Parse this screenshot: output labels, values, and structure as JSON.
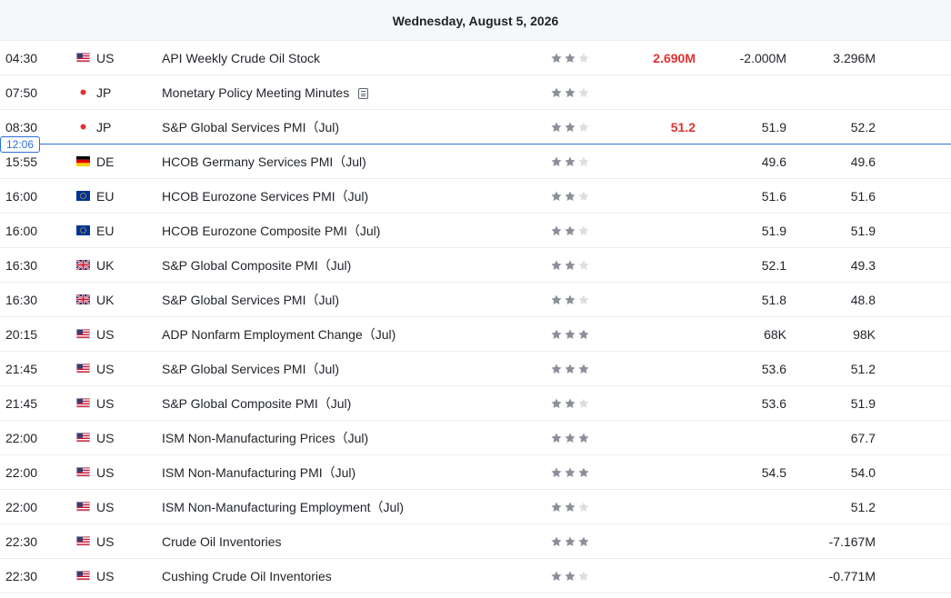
{
  "calendar": {
    "date": "Wednesday, August 5, 2026",
    "current_time": "12:06",
    "colors": {
      "actual": "#e0312e",
      "now_line": "#2f6fd6",
      "star_on": "#8b8f99",
      "star_off": "#dcdee2"
    },
    "events": [
      {
        "time": "04:30",
        "flag": "flag-us",
        "country": "US",
        "name": "API Weekly Crude Oil Stock",
        "memo": false,
        "importance": 2,
        "actual": "2.690M",
        "forecast": "-2.000M",
        "previous": "3.296M"
      },
      {
        "time": "07:50",
        "flag": "flag-jp",
        "country": "JP",
        "name": "Monetary Policy Meeting Minutes",
        "memo": true,
        "importance": 2,
        "actual": "",
        "forecast": "",
        "previous": ""
      },
      {
        "time": "08:30",
        "flag": "flag-jp",
        "country": "JP",
        "name": "S&P Global Services PMI（Jul)",
        "memo": false,
        "importance": 2,
        "actual": "51.2",
        "forecast": "51.9",
        "previous": "52.2"
      },
      {
        "time": "15:55",
        "flag": "flag-de",
        "country": "DE",
        "name": "HCOB Germany Services PMI（Jul)",
        "memo": false,
        "importance": 2,
        "actual": "",
        "forecast": "49.6",
        "previous": "49.6"
      },
      {
        "time": "16:00",
        "flag": "flag-eu",
        "country": "EU",
        "name": "HCOB Eurozone Services PMI（Jul)",
        "memo": false,
        "importance": 2,
        "actual": "",
        "forecast": "51.6",
        "previous": "51.6"
      },
      {
        "time": "16:00",
        "flag": "flag-eu",
        "country": "EU",
        "name": "HCOB Eurozone Composite PMI（Jul)",
        "memo": false,
        "importance": 2,
        "actual": "",
        "forecast": "51.9",
        "previous": "51.9"
      },
      {
        "time": "16:30",
        "flag": "flag-uk",
        "country": "UK",
        "name": "S&P Global Composite PMI（Jul)",
        "memo": false,
        "importance": 2,
        "actual": "",
        "forecast": "52.1",
        "previous": "49.3"
      },
      {
        "time": "16:30",
        "flag": "flag-uk",
        "country": "UK",
        "name": "S&P Global Services PMI（Jul)",
        "memo": false,
        "importance": 2,
        "actual": "",
        "forecast": "51.8",
        "previous": "48.8"
      },
      {
        "time": "20:15",
        "flag": "flag-us",
        "country": "US",
        "name": "ADP Nonfarm Employment Change（Jul)",
        "memo": false,
        "importance": 3,
        "actual": "",
        "forecast": "68K",
        "previous": "98K"
      },
      {
        "time": "21:45",
        "flag": "flag-us",
        "country": "US",
        "name": "S&P Global Services PMI（Jul)",
        "memo": false,
        "importance": 3,
        "actual": "",
        "forecast": "53.6",
        "previous": "51.2"
      },
      {
        "time": "21:45",
        "flag": "flag-us",
        "country": "US",
        "name": "S&P Global Composite PMI（Jul)",
        "memo": false,
        "importance": 2,
        "actual": "",
        "forecast": "53.6",
        "previous": "51.9"
      },
      {
        "time": "22:00",
        "flag": "flag-us",
        "country": "US",
        "name": "ISM Non-Manufacturing Prices（Jul)",
        "memo": false,
        "importance": 3,
        "actual": "",
        "forecast": "",
        "previous": "67.7"
      },
      {
        "time": "22:00",
        "flag": "flag-us",
        "country": "US",
        "name": "ISM Non-Manufacturing PMI（Jul)",
        "memo": false,
        "importance": 3,
        "actual": "",
        "forecast": "54.5",
        "previous": "54.0"
      },
      {
        "time": "22:00",
        "flag": "flag-us",
        "country": "US",
        "name": "ISM Non-Manufacturing Employment（Jul)",
        "memo": false,
        "importance": 2,
        "actual": "",
        "forecast": "",
        "previous": "51.2"
      },
      {
        "time": "22:30",
        "flag": "flag-us",
        "country": "US",
        "name": "Crude Oil Inventories",
        "memo": false,
        "importance": 3,
        "actual": "",
        "forecast": "",
        "previous": "-7.167M"
      },
      {
        "time": "22:30",
        "flag": "flag-us",
        "country": "US",
        "name": "Cushing Crude Oil Inventories",
        "memo": false,
        "importance": 2,
        "actual": "",
        "forecast": "",
        "previous": "-0.771M"
      }
    ]
  }
}
